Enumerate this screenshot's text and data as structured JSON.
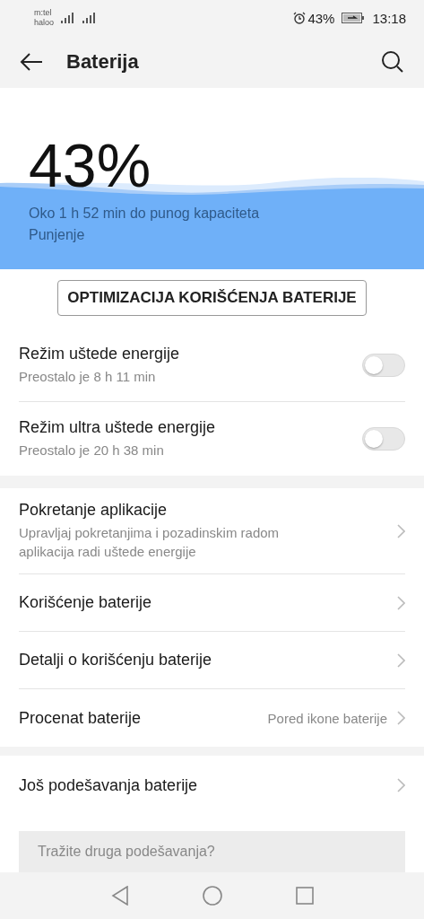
{
  "status_bar": {
    "carriers": [
      "m:tel",
      "haloo"
    ],
    "battery_percent": "43%",
    "time": "13:18"
  },
  "app_bar": {
    "title": "Baterija"
  },
  "hero": {
    "percent": "43%",
    "estimate": "Oko 1 h 52 min do punog kapaciteta",
    "state": "Punjenje"
  },
  "optimize_button": "OPTIMIZACIJA KORIŠĆENJA BATERIJE",
  "modes": [
    {
      "title": "Režim uštede energije",
      "subtitle": "Preostalo je 8 h 11 min",
      "on": false
    },
    {
      "title": "Režim ultra uštede energije",
      "subtitle": "Preostalo je 20 h 38 min",
      "on": false
    }
  ],
  "settings": [
    {
      "title": "Pokretanje aplikacije",
      "subtitle": "Upravljaj pokretanjima i pozadinskim radom aplikacija radi uštede energije"
    },
    {
      "title": "Korišćenje baterije"
    },
    {
      "title": "Detalji o korišćenju baterije"
    },
    {
      "title": "Procenat baterije",
      "value": "Pored ikone baterije"
    }
  ],
  "more_settings": [
    {
      "title": "Još podešavanja baterije"
    }
  ],
  "search_card": {
    "text": "Tražite druga podešavanja?"
  }
}
